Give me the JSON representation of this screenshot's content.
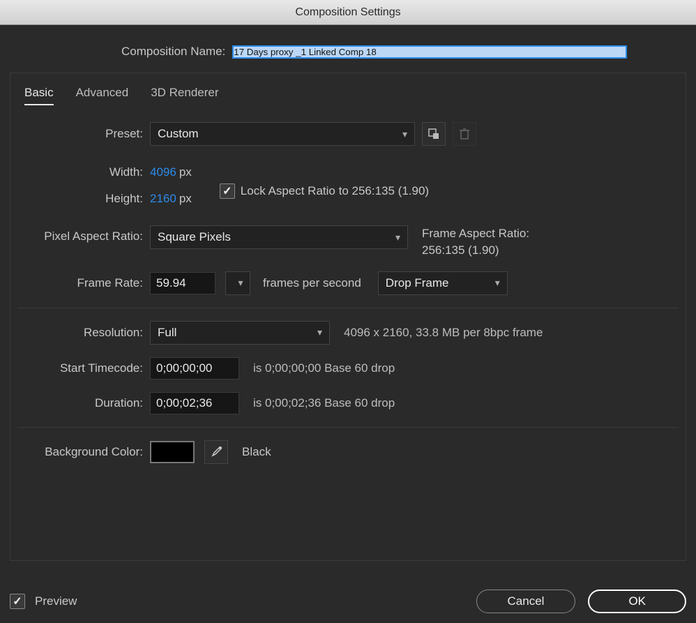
{
  "title": "Composition Settings",
  "name_label": "Composition Name:",
  "comp_name": "17 Days proxy _1 Linked Comp 18",
  "tabs": {
    "basic": "Basic",
    "advanced": "Advanced",
    "renderer": "3D Renderer"
  },
  "preset": {
    "label": "Preset:",
    "value": "Custom"
  },
  "width": {
    "label": "Width:",
    "value": "4096",
    "unit": "px"
  },
  "height": {
    "label": "Height:",
    "value": "2160",
    "unit": "px"
  },
  "lock_aspect": "Lock Aspect Ratio to 256:135 (1.90)",
  "par": {
    "label": "Pixel Aspect Ratio:",
    "value": "Square Pixels"
  },
  "far": {
    "label": "Frame Aspect Ratio:",
    "value": "256:135 (1.90)"
  },
  "fr": {
    "label": "Frame Rate:",
    "value": "59.94",
    "text": "frames per second",
    "drop": "Drop Frame"
  },
  "res": {
    "label": "Resolution:",
    "value": "Full",
    "info": "4096 x 2160, 33.8 MB per 8bpc frame"
  },
  "start": {
    "label": "Start Timecode:",
    "value": "0;00;00;00",
    "info": "is 0;00;00;00  Base 60  drop"
  },
  "duration": {
    "label": "Duration:",
    "value": "0;00;02;36",
    "info": "is 0;00;02;36  Base 60  drop"
  },
  "bg": {
    "label": "Background Color:",
    "name": "Black",
    "color": "#000000"
  },
  "preview": "Preview",
  "cancel": "Cancel",
  "ok": "OK"
}
